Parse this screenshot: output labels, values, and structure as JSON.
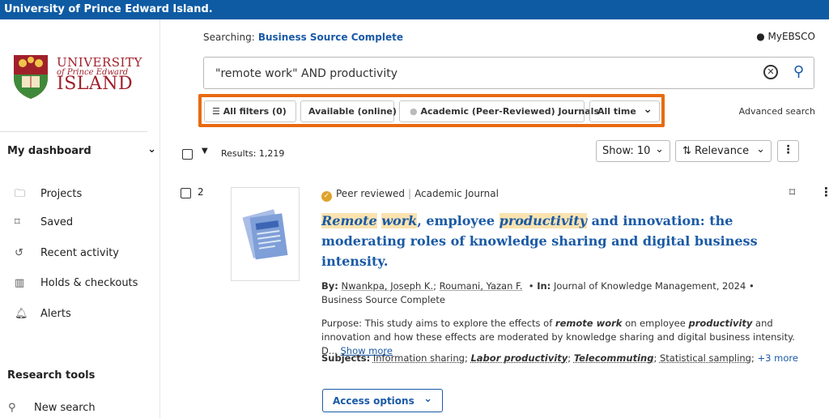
{
  "topbar": {
    "title": "University of Prince Edward Island."
  },
  "logo": {
    "line1": "UNIVERSITY",
    "line2": "of Prince Edward",
    "line3": "ISLAND"
  },
  "sidebar": {
    "dashboard_label": "My dashboard",
    "items": [
      {
        "label": "Projects",
        "icon": "folder-icon"
      },
      {
        "label": "Saved",
        "icon": "bookmark-icon"
      },
      {
        "label": "Recent activity",
        "icon": "history-icon"
      },
      {
        "label": "Holds & checkouts",
        "icon": "books-icon"
      },
      {
        "label": "Alerts",
        "icon": "bell-icon"
      }
    ],
    "research_tools_label": "Research tools",
    "new_search_label": "New search"
  },
  "header": {
    "searching_label": "Searching:",
    "database": "Business Source Complete",
    "myebsco": "MyEBSCO"
  },
  "search": {
    "query": "\"remote work\" AND productivity"
  },
  "filters": {
    "all_filters": "All filters (0)",
    "available": "Available (online)",
    "academic": "Academic (Peer-Reviewed) Journals",
    "time": "All time",
    "advanced": "Advanced search"
  },
  "results_bar": {
    "count": "Results: 1,219",
    "show": "Show: 10",
    "sort": "Relevance"
  },
  "result": {
    "number": "2",
    "peer_reviewed": "Peer reviewed",
    "type": "Academic Journal",
    "title_parts": {
      "hl1": "Remote",
      "hl2": "work",
      "mid": ", employee ",
      "hl3": "productivity",
      "rest": " and innovation: the moderating roles of knowledge sharing and digital business intensity."
    },
    "by_label": "By:",
    "author1": "Nwankpa, Joseph K.",
    "author2": "Roumani, Yazan F.",
    "in_label": "In:",
    "source": "Journal of Knowledge Management, 2024",
    "database": "Business Source Complete",
    "abstract_start": "Purpose: This study aims to explore the effects of ",
    "abstract_hl1": "remote work",
    "abstract_mid": " on employee ",
    "abstract_hl2": "productivity",
    "abstract_end": " and innovation and how these effects are moderated by knowledge sharing and digital business intensity. D...",
    "show_more": "Show more",
    "subjects_label": "Subjects:",
    "subjects": [
      "Information sharing",
      "Labor productivity",
      "Telecommuting",
      "Statistical sampling"
    ],
    "more_subjects": "+3 more",
    "access_label": "Access options"
  },
  "colors": {
    "brand": "#0e5ba3",
    "accent": "#1a5aa6",
    "highlight": "#fbe3b0",
    "filter_outline": "#e86a10",
    "logo": "#a0202a"
  }
}
